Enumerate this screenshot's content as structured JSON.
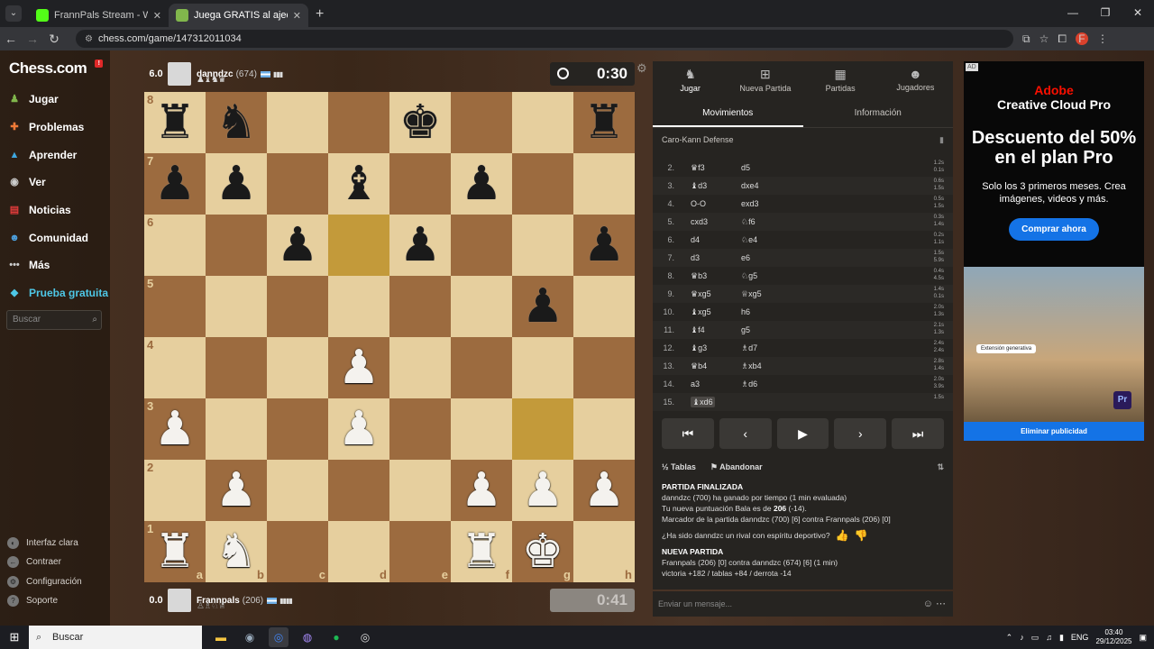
{
  "browser": {
    "tabs": [
      {
        "title": "FrannPals Stream - Watch Live"
      },
      {
        "title": "Juega GRATIS al ajedrez online"
      }
    ],
    "url": "chess.com/game/147312011034"
  },
  "sidebar": {
    "logo": "Chess.com",
    "items": [
      {
        "label": "Jugar",
        "color": "#81b64c"
      },
      {
        "label": "Problemas",
        "color": "#f07a37"
      },
      {
        "label": "Aprender",
        "color": "#3ea7e0"
      },
      {
        "label": "Ver",
        "color": "#cccccc"
      },
      {
        "label": "Noticias",
        "color": "#e23b3b"
      },
      {
        "label": "Comunidad",
        "color": "#4da1e0"
      },
      {
        "label": "Más",
        "color": "#cccccc"
      },
      {
        "label": "Prueba gratuita",
        "color": "#4ec7e6"
      }
    ],
    "search_placeholder": "Buscar",
    "footer": [
      "Interfaz clara",
      "Contraer",
      "Configuración",
      "Soporte"
    ]
  },
  "top_player": {
    "score": "6.0",
    "name": "danndzc",
    "rating": "(674)",
    "clock": "0:30"
  },
  "bottom_player": {
    "score": "0.0",
    "name": "Frannpals",
    "rating": "(206)",
    "clock": "0:41"
  },
  "board": {
    "ranks": [
      "8",
      "7",
      "6",
      "5",
      "4",
      "3",
      "2",
      "1"
    ],
    "files": [
      "a",
      "b",
      "c",
      "d",
      "e",
      "f",
      "g",
      "h"
    ],
    "position": [
      [
        "bR",
        "bN",
        "",
        "",
        "bK",
        "",
        "",
        "bR"
      ],
      [
        "bP",
        "bP",
        "",
        "bB",
        "",
        "bP",
        "",
        ""
      ],
      [
        "",
        "",
        "bP",
        "",
        "bP",
        "",
        "",
        "bP"
      ],
      [
        "",
        "",
        "",
        "",
        "",
        "",
        "bP",
        ""
      ],
      [
        "",
        "",
        "",
        "wP",
        "",
        "",
        "",
        ""
      ],
      [
        "wP",
        "",
        "",
        "wP",
        "",
        "",
        "",
        ""
      ],
      [
        "",
        "wP",
        "",
        "",
        "",
        "wP",
        "wP",
        "wP"
      ],
      [
        "wR",
        "wN",
        "",
        "",
        "",
        "wR",
        "wK",
        ""
      ]
    ],
    "highlight": [
      "d6",
      "g3"
    ]
  },
  "panel": {
    "tabs": [
      "Jugar",
      "Nueva Partida",
      "Partidas",
      "Jugadores"
    ],
    "subtabs": [
      "Movimientos",
      "Información"
    ],
    "opening": "Caro-Kann Defense",
    "moves": [
      {
        "n": "2.",
        "w": "♛f3",
        "b": "d5",
        "tw": "1.2s",
        "tb": "0.1s"
      },
      {
        "n": "3.",
        "w": "♝d3",
        "b": "dxe4",
        "tw": "0.6s",
        "tb": "1.5s"
      },
      {
        "n": "4.",
        "w": "O-O",
        "b": "exd3",
        "tw": "0.5s",
        "tb": "1.5s"
      },
      {
        "n": "5.",
        "w": "cxd3",
        "b": "♘f6",
        "tw": "0.3s",
        "tb": "1.4s"
      },
      {
        "n": "6.",
        "w": "d4",
        "b": "♘e4",
        "tw": "0.2s",
        "tb": "1.1s"
      },
      {
        "n": "7.",
        "w": "d3",
        "b": "e6",
        "tw": "1.5s",
        "tb": "5.9s"
      },
      {
        "n": "8.",
        "w": "♛b3",
        "b": "♘g5",
        "tw": "0.4s",
        "tb": "4.5s"
      },
      {
        "n": "9.",
        "w": "♛xg5",
        "b": "♕xg5",
        "tw": "1.4s",
        "tb": "0.1s"
      },
      {
        "n": "10.",
        "w": "♝xg5",
        "b": "h6",
        "tw": "2.0s",
        "tb": "1.3s"
      },
      {
        "n": "11.",
        "w": "♝f4",
        "b": "g5",
        "tw": "2.1s",
        "tb": "1.3s"
      },
      {
        "n": "12.",
        "w": "♝g3",
        "b": "♗d7",
        "tw": "2.4s",
        "tb": "2.4s"
      },
      {
        "n": "13.",
        "w": "♛b4",
        "b": "♗xb4",
        "tw": "2.8s",
        "tb": "1.4s"
      },
      {
        "n": "14.",
        "w": "a3",
        "b": "♗d6",
        "tw": "2.0s",
        "tb": "3.9s"
      },
      {
        "n": "15.",
        "w": "♝xd6",
        "b": "",
        "tw": "1.5s",
        "tb": ""
      }
    ],
    "actions": {
      "draw": "Tablas",
      "resign": "Abandonar"
    },
    "log": {
      "title": "PARTIDA FINALIZADA",
      "line1": "danndzc (700) ha ganado por tiempo (1 min evaluada)",
      "line2_a": "Tu nueva puntuación Bala es de ",
      "line2_b": "206",
      "line2_c": " (-14).",
      "line3": "Marcador de la partida danndzc (700) [6] contra Frannpals (206) [0]",
      "question": "¿Ha sido danndzc un rival con espíritu deportivo?",
      "title2": "NUEVA PARTIDA",
      "line4": "Frannpals (206) [0] contra danndzc (674) [6] (1 min)",
      "line5": "victoria +182 / tablas +84 / derrota -14"
    },
    "message_placeholder": "Enviar un mensaje..."
  },
  "ad": {
    "tag": "AD",
    "brand": "Adobe",
    "product": "Creative Cloud Pro",
    "headline": "Descuento del 50% en el plan Pro",
    "body": "Solo los 3 primeros meses. Crea imágenes, videos y más.",
    "cta": "Comprar ahora",
    "chip": "Extensión generativa",
    "app": "Pr",
    "footer": "Eliminar publicidad"
  },
  "taskbar": {
    "search": "Buscar",
    "lang": "ENG",
    "time": "03:40",
    "date": "29/12/2025"
  }
}
